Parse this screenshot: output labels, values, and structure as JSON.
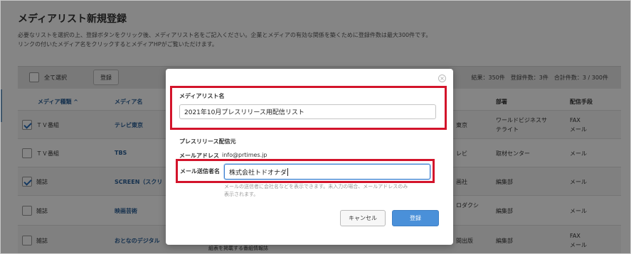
{
  "page": {
    "title": "メディアリスト新規登録",
    "description_line1": "必要なリストを選択の上、登録ボタンをクリック後、メディアリスト名をご記入ください。企業とメディアの有効な関係を築くために登録件数は最大300件です。",
    "description_line2": "リンクの付いたメディア名をクリックするとメディアHPがご覧いただけます。"
  },
  "toolbar": {
    "select_all_label": "全て選択",
    "register_label": "登録",
    "stats": "結果：350件　登録件数：3件　合計件数：3 / 300件"
  },
  "table": {
    "headers": {
      "media_type": "メディア種類 ^",
      "media_name": "メディア名",
      "department": "部署",
      "delivery": "配信手段"
    },
    "rows": [
      {
        "type": "ＴＶ番組",
        "name": "テレビ東京",
        "company": "東京",
        "department": "ワールドビジネスサ\nテライト",
        "delivery": "FAX\nメール",
        "checked": true
      },
      {
        "type": "ＴＶ番組",
        "name": "TBS",
        "company": "レビ",
        "department": "取材センター",
        "delivery": "メール",
        "checked": false
      },
      {
        "type": "雑誌",
        "name": "SCREEN（スクリ",
        "company": "画社",
        "department": "編集部",
        "delivery": "メール",
        "checked": true
      },
      {
        "type": "雑誌",
        "name": "映画芸術",
        "company": "ロダクシ",
        "department": "編集部",
        "delivery": "メール",
        "checked": false
      },
      {
        "type": "雑誌",
        "name": "おとなのデジタル",
        "company": "間出版",
        "department": "編集部",
        "delivery": "FAX\nメール",
        "checked": false
      }
    ],
    "below_text": "組表を掲載する番組情報誌"
  },
  "modal": {
    "close_symbol": "×",
    "list_name_label": "メディアリスト名",
    "list_name_value": "2021年10月プレスリリース用配信リスト",
    "sender_section_label": "プレスリリース配信元",
    "mail_address_label": "メールアドレス",
    "mail_address_value": "info@prtimes.jp",
    "sender_name_label": "メール送信者名",
    "sender_name_value": "株式会社トドオナダ",
    "sender_note_line1": "メールの送信者に会社名などを表示できます。未入力の場合、メールアドレスのみ",
    "sender_note_line2": "表示されます。",
    "cancel_label": "キャンセル",
    "submit_label": "登録"
  },
  "colors": {
    "highlight_red": "#d3142b",
    "primary_blue": "#4a90d9",
    "link_blue": "#2a5e96"
  }
}
